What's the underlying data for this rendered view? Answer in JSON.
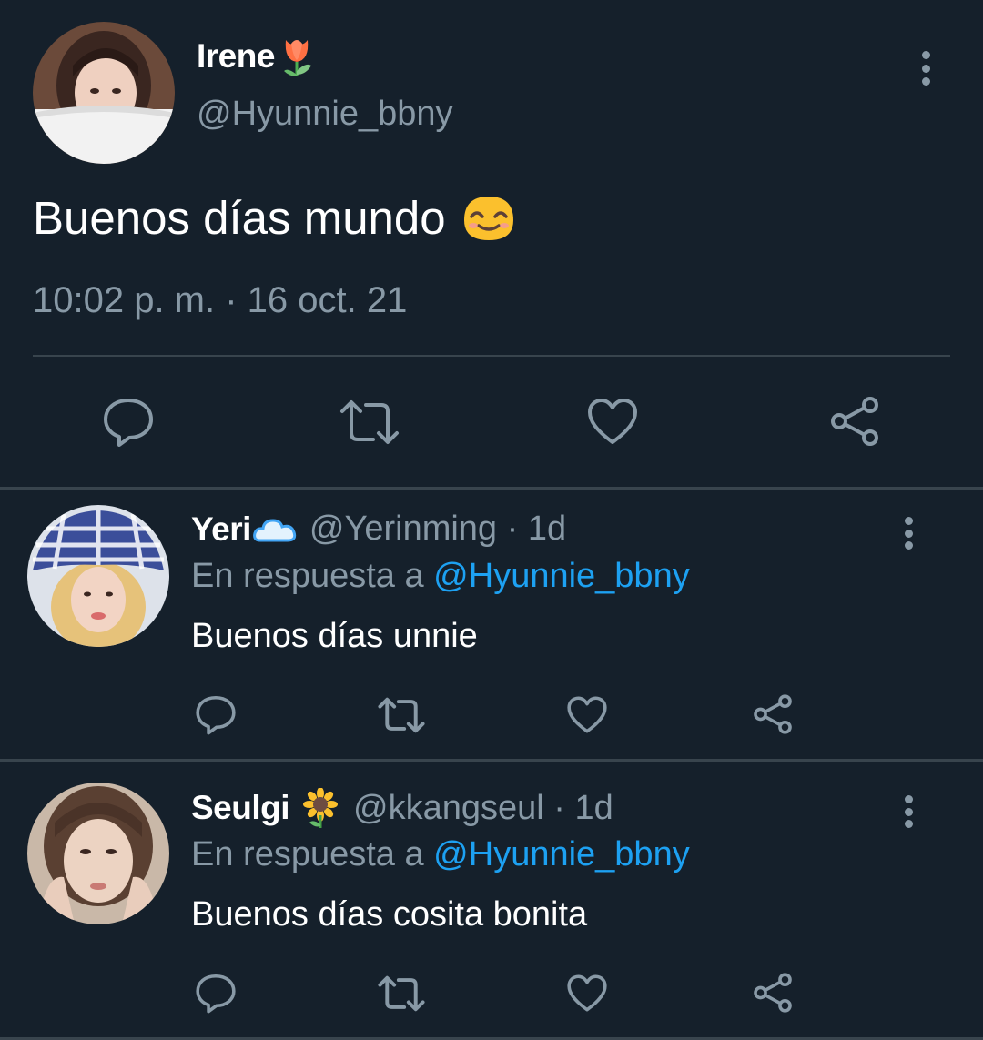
{
  "main_tweet": {
    "display_name": "Irene",
    "name_emoji": "tulip-emoji",
    "handle": "@Hyunnie_bbny",
    "text": "Buenos días mundo",
    "text_emoji": "smiling-face-emoji",
    "timestamp": "10:02 p. m. · 16 oct. 21"
  },
  "replies": [
    {
      "display_name": "Yeri",
      "name_emoji": "cloud-emoji",
      "handle_meta": "@Yerinming · 1d",
      "reply_prefix": "En respuesta a",
      "reply_mention": "@Hyunnie_bbny",
      "text": "Buenos días unnie"
    },
    {
      "display_name": "Seulgi",
      "name_emoji": "sunflower-emoji",
      "handle_meta": "@kkangseul · 1d",
      "reply_prefix": "En respuesta a",
      "reply_mention": "@Hyunnie_bbny",
      "text": "Buenos días cosita bonita"
    }
  ],
  "actions": [
    "reply-icon",
    "retweet-icon",
    "like-icon",
    "share-icon"
  ],
  "colors": {
    "background": "#15202b",
    "secondary_text": "#8899a6",
    "divider": "#38444d",
    "mention": "#1da1f2"
  }
}
